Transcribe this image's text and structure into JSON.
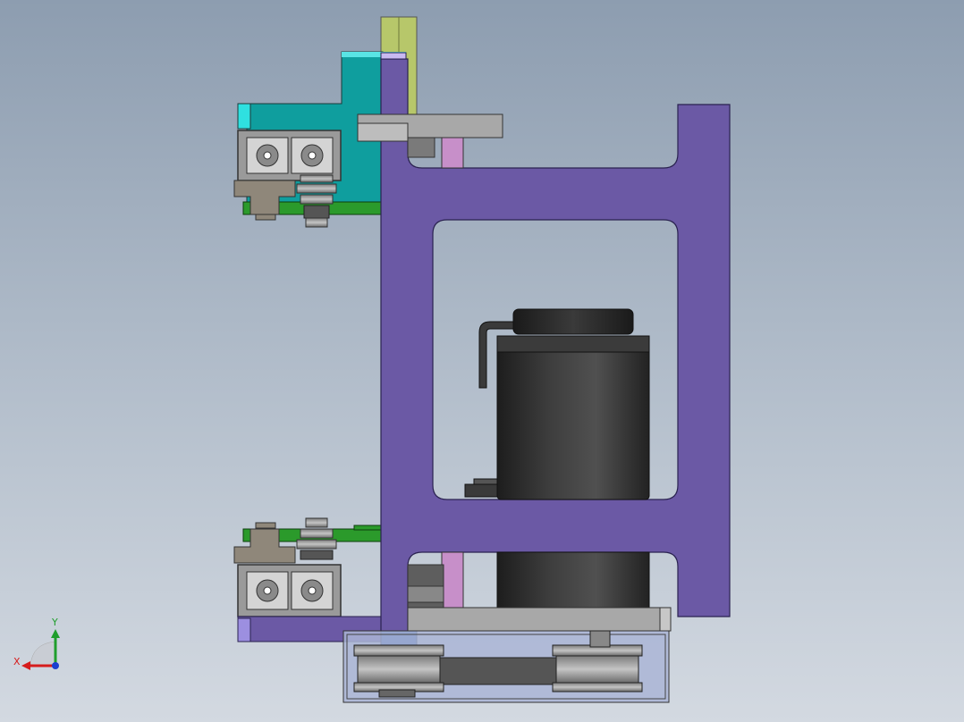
{
  "app": {
    "view": "front",
    "background_top": "#8d9db0",
    "background_bottom": "#d3d9e1"
  },
  "triad": {
    "x_label": "X",
    "y_label": "Y",
    "x_color": "#d61c1c",
    "y_color": "#1f9e2c",
    "z_color": "#1b3fd0"
  },
  "parts": {
    "frame_color": "#6b59a5",
    "teal_bracket_color": "#0f9e9e",
    "extrusion_color": "#9a9a9a",
    "motor_color": "#2f2f2f",
    "belt_housing_color": "#aab5d6",
    "rod_color": "#c78fc9",
    "pcb_color": "#2b9a2b",
    "guide_color": "#b7c76a"
  }
}
